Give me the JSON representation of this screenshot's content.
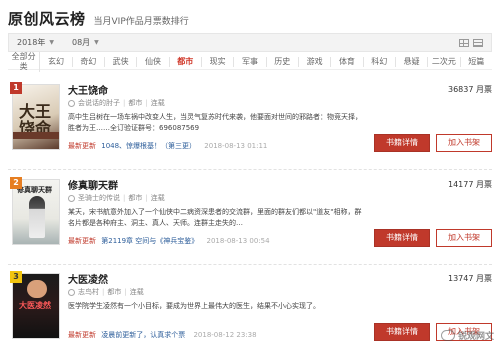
{
  "header": {
    "title": "原创风云榜",
    "subtitle": "当月VIP作品月票数排行"
  },
  "filters": {
    "year": "2018年",
    "month": "08月"
  },
  "categories": [
    "全部分类",
    "玄幻",
    "奇幻",
    "武侠",
    "仙侠",
    "都市",
    "现实",
    "军事",
    "历史",
    "游戏",
    "体育",
    "科幻",
    "悬疑",
    "二次元",
    "短篇"
  ],
  "active_category": "都市",
  "books": [
    {
      "rank": "1",
      "title": "大王饶命",
      "author": "会说话的肘子",
      "category": "都市",
      "status": "连载",
      "desc": "高中生吕树在一场车祸中改变人生，当灵气复苏时代来袭，他要面对世间的邪路者：物竞天择，胜者为王……全订验证群号：696087569",
      "update_label": "最新更新",
      "update_chapter": "1048、惊爆根基！（第三更）",
      "update_time": "2018-08-13 01:11",
      "votes": "36837 月票",
      "cover_text": "大王饶命"
    },
    {
      "rank": "2",
      "title": "修真聊天群",
      "author": "圣骑士的传说",
      "category": "都市",
      "status": "连载",
      "desc": "某天，宋书航意外加入了一个仙侠中二病资深患者的交流群，里面的群友们都以\"道友\"相称，群名片都是各种府主、洞主、真人、天师。连群主走失的…",
      "update_label": "最新更新",
      "update_chapter": "第2119章 空间与《神兵宝鉴》",
      "update_time": "2018-08-13 00:54",
      "votes": "14177 月票",
      "cover_text": "修真聊天群"
    },
    {
      "rank": "3",
      "title": "大医凌然",
      "author": "志鸟村",
      "category": "都市",
      "status": "连载",
      "desc": "医学院学生凌然有一个小目标，要成为世界上最伟大的医生，结果不小心实现了。",
      "update_label": "最新更新",
      "update_chapter": "凌晨前更新了，认真求个票",
      "update_time": "2018-08-12 23:38",
      "votes": "13747 月票",
      "cover_text": "大医凌然"
    }
  ],
  "buttons": {
    "detail": "书籍详情",
    "shelf": "加入书架"
  },
  "watermark": "锐观网文"
}
